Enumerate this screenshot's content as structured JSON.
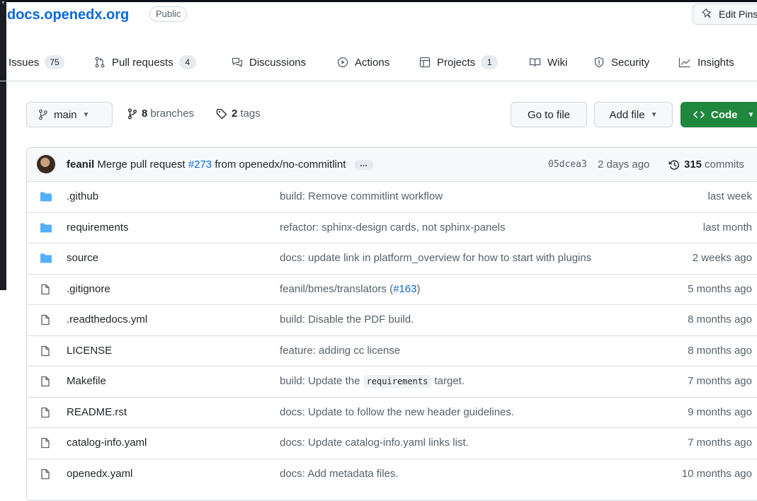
{
  "repo": {
    "name": "docs.openedx.org",
    "visibility": "Public",
    "edit_pins_label": "Edit Pins"
  },
  "nav": {
    "issues": {
      "label": "Issues",
      "count": "75"
    },
    "pulls": {
      "label": "Pull requests",
      "count": "4"
    },
    "discussions": {
      "label": "Discussions"
    },
    "actions": {
      "label": "Actions"
    },
    "projects": {
      "label": "Projects",
      "count": "1"
    },
    "wiki": {
      "label": "Wiki"
    },
    "security": {
      "label": "Security"
    },
    "insights": {
      "label": "Insights"
    }
  },
  "toolbar": {
    "branch": "main",
    "branches_count": "8",
    "branches_label": "branches",
    "tags_count": "2",
    "tags_label": "tags",
    "goto_label": "Go to file",
    "addfile_label": "Add file",
    "code_label": "Code"
  },
  "commit": {
    "author": "feanil",
    "msg_prefix": "Merge pull request",
    "pr": "#273",
    "msg_suffix": "from openedx/no-commitlint",
    "ellipsis": "...",
    "sha": "05dcea3",
    "date": "2 days ago",
    "count": "315",
    "count_label": "commits"
  },
  "files": [
    {
      "type": "dir",
      "name": ".github",
      "msg": "build: Remove commitlint workflow",
      "date": "last week"
    },
    {
      "type": "dir",
      "name": "requirements",
      "msg": "refactor: sphinx-design cards, not sphinx-panels",
      "date": "last month"
    },
    {
      "type": "dir",
      "name": "source",
      "msg": "docs: update link in platform_overview for how to start with plugins",
      "date": "2 weeks ago"
    },
    {
      "type": "file",
      "name": ".gitignore",
      "msg": "feanil/bmes/translators (",
      "msg_link": "#163",
      "msg_after": ")",
      "date": "5 months ago"
    },
    {
      "type": "file",
      "name": ".readthedocs.yml",
      "msg": "build: Disable the PDF build.",
      "date": "8 months ago"
    },
    {
      "type": "file",
      "name": "LICENSE",
      "msg": "feature: adding cc license",
      "date": "8 months ago"
    },
    {
      "type": "file",
      "name": "Makefile",
      "msg": "build: Update the",
      "msg_code": "requirements",
      "msg_after": "target.",
      "date": "7 months ago"
    },
    {
      "type": "file",
      "name": "README.rst",
      "msg": "docs: Update to follow the new header guidelines.",
      "date": "9 months ago"
    },
    {
      "type": "file",
      "name": "catalog-info.yaml",
      "msg": "docs: Update catalog-info.yaml links list.",
      "date": "7 months ago"
    },
    {
      "type": "file",
      "name": "openedx.yaml",
      "msg": "docs: Add metadata files.",
      "date": "10 months ago"
    }
  ],
  "colors": {
    "accent": "#0969da",
    "folder": "#54aeff",
    "code_button": "#1f883d"
  }
}
